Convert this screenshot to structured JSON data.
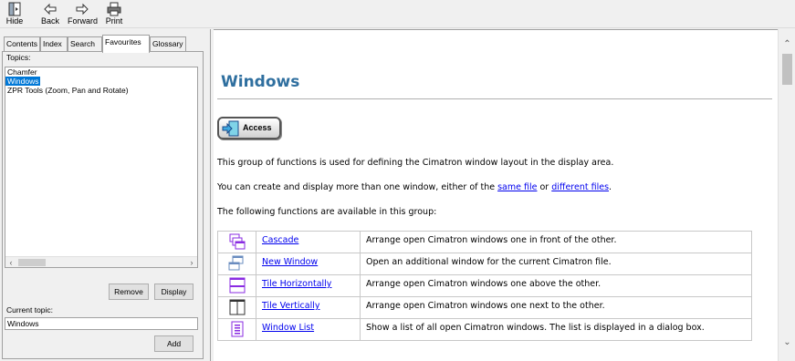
{
  "toolbar": {
    "hide": "Hide",
    "back": "Back",
    "forward": "Forward",
    "print": "Print"
  },
  "tabs": [
    "Contents",
    "Index",
    "Search",
    "Favourites",
    "Glossary"
  ],
  "left": {
    "topics_label": "Topics:",
    "topics": [
      "Chamfer",
      "Windows",
      "ZPR Tools (Zoom, Pan and Rotate)"
    ],
    "remove": "Remove",
    "display": "Display",
    "current_topic_label": "Current topic:",
    "current_topic_value": "Windows",
    "add": "Add"
  },
  "content": {
    "title": "Windows",
    "access": "Access",
    "p1": "This group of functions is used for defining the Cimatron window layout in the display area.",
    "p2_pre": "You can create and display more than one window, either of the ",
    "p2_link1": "same file",
    "p2_mid": " or ",
    "p2_link2": "different files",
    "p2_post": ".",
    "p3": "The following functions are available in this group:",
    "functions": [
      {
        "name": "Cascade",
        "desc": "Arrange open Cimatron windows one in front of the other.",
        "icon": "cascade-icon"
      },
      {
        "name": "New Window",
        "desc": "Open an additional window for the current Cimatron file.",
        "icon": "new-window-icon"
      },
      {
        "name": "Tile Horizontally",
        "desc": "Arrange open Cimatron windows one above the other.",
        "icon": "tile-horizontal-icon"
      },
      {
        "name": "Tile Vertically",
        "desc": "Arrange open Cimatron windows one next to the other.",
        "icon": "tile-vertical-icon"
      },
      {
        "name": "Window List",
        "desc": "Show a list of all open Cimatron windows. The list is displayed in a dialog box.",
        "icon": "window-list-icon"
      }
    ]
  },
  "colors": {
    "title": "#2f6f9f",
    "link": "#0000ee",
    "selection": "#0078d7",
    "icon_purple": "#8a2be2"
  }
}
